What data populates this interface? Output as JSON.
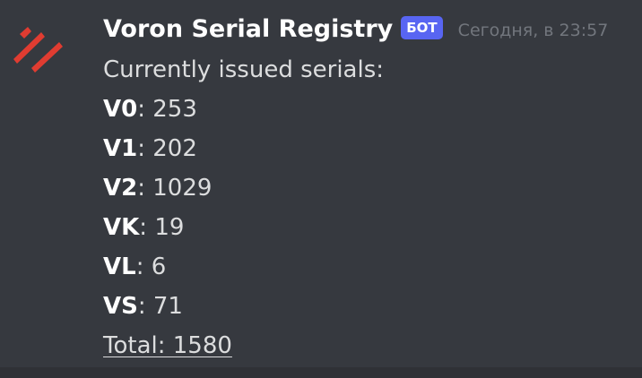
{
  "message": {
    "author": "Voron Serial Registry",
    "bot_tag": "БОТ",
    "timestamp": "Сегодня, в 23:57",
    "intro": "Currently issued serials:",
    "serials": [
      {
        "model": "V0",
        "sep": ": ",
        "count": "253"
      },
      {
        "model": "V1",
        "sep": ": ",
        "count": "202"
      },
      {
        "model": "V2",
        "sep": ": ",
        "count": "1029"
      },
      {
        "model": "VK",
        "sep": ": ",
        "count": "19"
      },
      {
        "model": "VL",
        "sep": ": ",
        "count": "6"
      },
      {
        "model": "VS",
        "sep": ": ",
        "count": "71"
      }
    ],
    "total": "Total: 1580"
  },
  "avatar": {
    "icon": "voron-logo-icon",
    "color": "#e03c31"
  },
  "colors": {
    "background": "#36393f",
    "bot_tag": "#5865f2",
    "username": "#ffffff",
    "timestamp": "#72767d",
    "text": "#dcddde"
  }
}
